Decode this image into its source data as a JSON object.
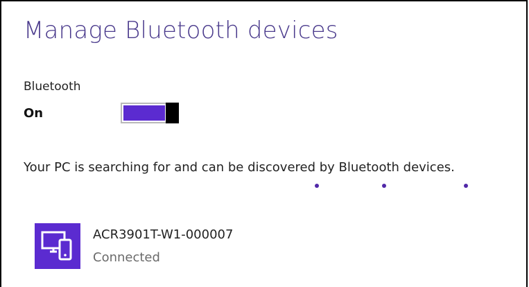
{
  "page": {
    "title": "Manage Bluetooth devices"
  },
  "bluetooth": {
    "label": "Bluetooth",
    "state_label": "On",
    "toggle_on": true,
    "accent_color": "#5b2bd0"
  },
  "status": {
    "search_text": "Your PC is searching for and can be discovered by Bluetooth devices.",
    "progress_dots": 3
  },
  "devices": [
    {
      "name": "ACR3901T-W1-000007",
      "status": "Connected",
      "icon": "pc-phone-icon",
      "tile_color": "#5b2bd0"
    }
  ]
}
